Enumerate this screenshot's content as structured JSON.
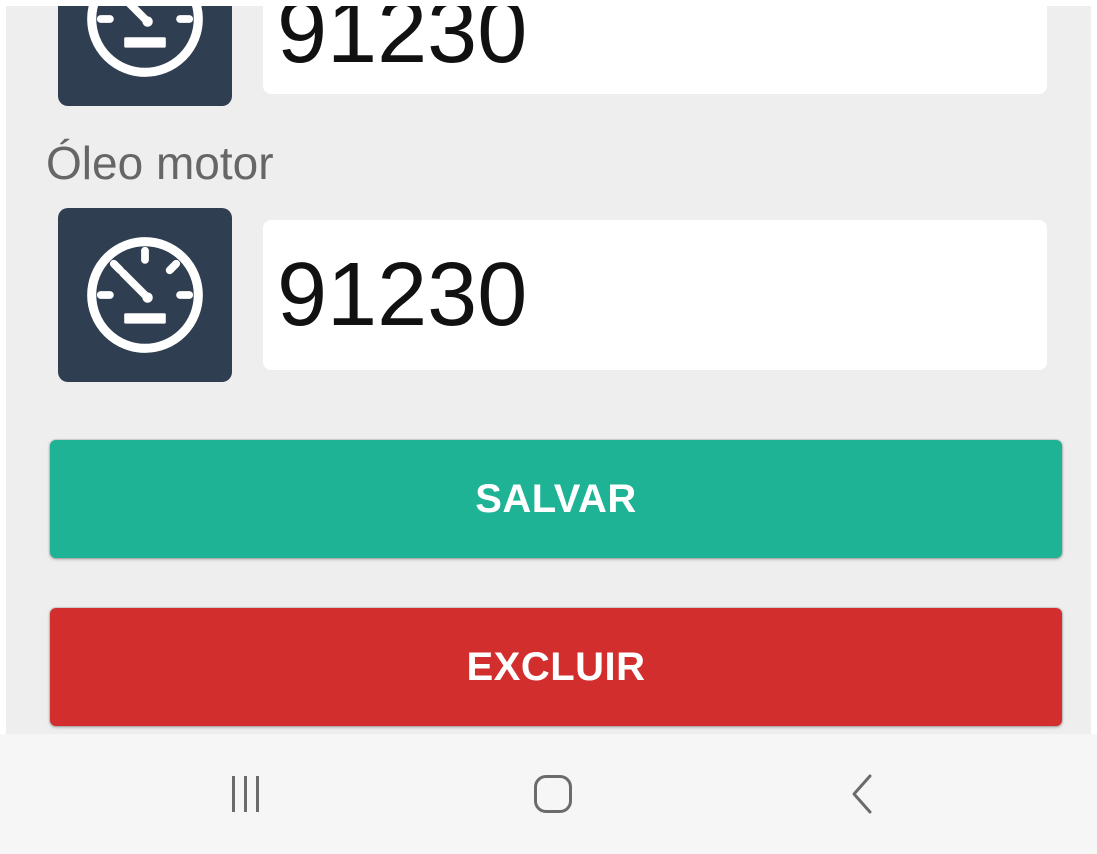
{
  "fields": [
    {
      "value": "91230"
    },
    {
      "label": "Óleo motor",
      "value": "91230"
    }
  ],
  "buttons": {
    "save_label": "SALVAR",
    "delete_label": "EXCLUIR"
  },
  "icons": {
    "field_icon": "speedometer-icon",
    "recents": "recents-icon",
    "home": "home-icon",
    "back": "back-icon"
  },
  "colors": {
    "icon_background": "#2f3e50",
    "save_button": "#1eb394",
    "delete_button": "#d32e2e",
    "content_background": "#eeeeee"
  }
}
